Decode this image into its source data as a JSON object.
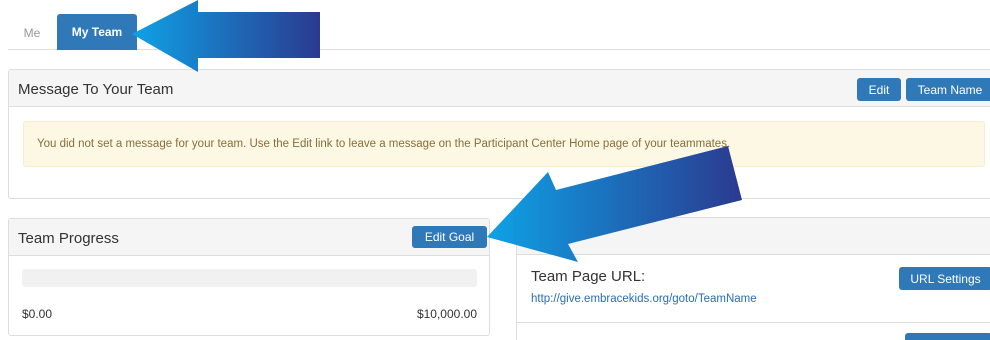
{
  "tabs": [
    {
      "label": "Me",
      "active": false
    },
    {
      "label": "My Team",
      "active": true
    }
  ],
  "message_panel": {
    "title": "Message To Your Team",
    "edit_label": "Edit",
    "team_name_label": "Team Name",
    "alert_text": "You did not set a message for your team. Use the Edit link to leave a message on the Participant Center Home page of your teammates."
  },
  "progress_panel": {
    "title": "Team Progress",
    "edit_goal_label": "Edit Goal",
    "raised": "$0.00",
    "goal": "$10,000.00",
    "progress_fraction": 0
  },
  "team_page": {
    "title": "Team Page URL:",
    "url": "http://give.embracekids.org/goto/TeamName",
    "url_settings_label": "URL Settings"
  },
  "colors": {
    "primary": "#2f79b9",
    "alert_bg": "#fcf8e3",
    "alert_text": "#8a6d3b",
    "arrow_light": "#0ea2e6",
    "arrow_dark": "#2b3a8f"
  },
  "icons": [
    "pointer-arrow-icon",
    "pointer-arrow-icon"
  ]
}
